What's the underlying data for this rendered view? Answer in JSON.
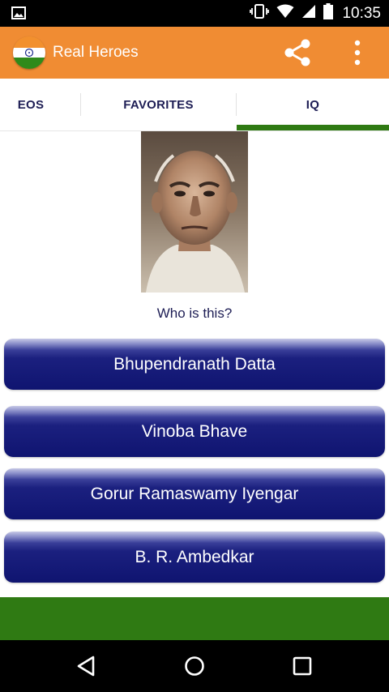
{
  "status_bar": {
    "time": "10:35",
    "icons": [
      "image-notification-icon",
      "vibrate-icon",
      "wifi-icon",
      "signal-icon",
      "battery-icon"
    ]
  },
  "app_bar": {
    "title": "Real Heroes",
    "logo": "india-flag-logo",
    "actions": [
      "share-icon",
      "more-vert-icon"
    ],
    "background": "#f08c33"
  },
  "tabs": {
    "items": [
      {
        "label": "EOS"
      },
      {
        "label": "FAVORITES"
      },
      {
        "label": "IQ"
      }
    ],
    "selected": "IQ",
    "indicator_color": "#2f7a13"
  },
  "quiz": {
    "question": "Who is this?",
    "answers": [
      {
        "label": "Bhupendranath Datta"
      },
      {
        "label": "Vinoba Bhave"
      },
      {
        "label": "Gorur Ramaswamy Iyengar"
      },
      {
        "label": "B. R. Ambedkar"
      }
    ]
  },
  "nav_bar": {
    "buttons": [
      "back-icon",
      "home-icon",
      "recents-icon"
    ]
  },
  "colors": {
    "accent": "#f08c33",
    "green": "#2f7a13",
    "button_navy": "#0f1470",
    "text_navy": "#1e1e55"
  }
}
